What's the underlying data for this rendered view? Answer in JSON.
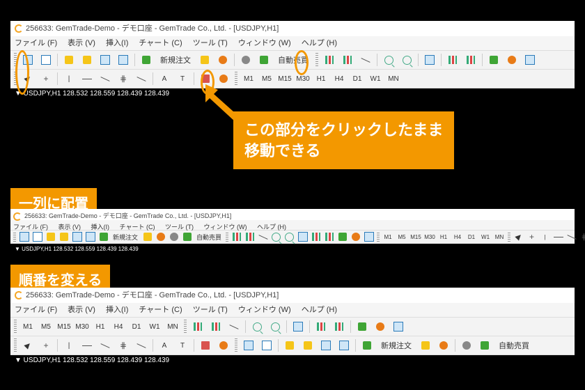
{
  "title": "256633: GemTrade-Demo - デモ口座 - GemTrade Co., Ltd. - [USDJPY,H1]",
  "menu": {
    "file": "ファイル (F)",
    "view": "表示 (V)",
    "insert": "挿入(I)",
    "chart": "チャート (C)",
    "tool": "ツール (T)",
    "window": "ウィンドウ (W)",
    "help": "ヘルプ (H)"
  },
  "buttons": {
    "neworder": "新規注文",
    "auto": "自動売買"
  },
  "timeframes": [
    "M1",
    "M5",
    "M15",
    "M30",
    "H1",
    "H4",
    "D1",
    "W1",
    "MN"
  ],
  "status": "▼ USDJPY,H1 128.532 128.559 128.439 128.439",
  "callout": {
    "l1": "この部分をクリックしたまま",
    "l2": "移動できる"
  },
  "label1": "一列に配置",
  "label2": "順番を変える",
  "glyphs": {
    "A": "A",
    "T": "T",
    "plus": "+",
    "minus": "—",
    "hash": "⋕",
    "dash": "—",
    "vline": "|"
  }
}
